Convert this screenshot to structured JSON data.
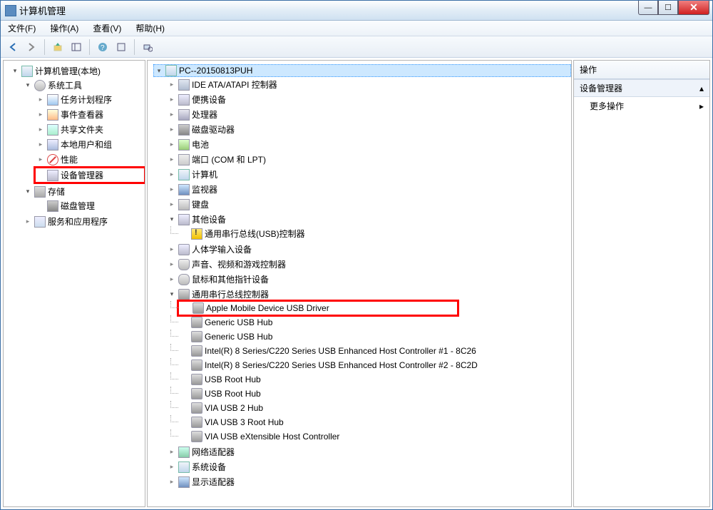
{
  "window": {
    "title": "计算机管理"
  },
  "menu": {
    "file": "文件(F)",
    "action": "操作(A)",
    "view": "查看(V)",
    "help": "帮助(H)"
  },
  "winbtns": {
    "min": "—",
    "max": "☐",
    "close": "✕"
  },
  "nav": {
    "root": "计算机管理(本地)",
    "systools": "系统工具",
    "task": "任务计划程序",
    "event": "事件查看器",
    "share": "共享文件夹",
    "users": "本地用户和组",
    "perf": "性能",
    "devmgr": "设备管理器",
    "storage": "存储",
    "diskmgr": "磁盘管理",
    "services": "服务和应用程序"
  },
  "device": {
    "computer": "PC--20150813PUH",
    "ide": "IDE ATA/ATAPI 控制器",
    "portable": "便携设备",
    "cpu": "处理器",
    "cdrom": "磁盘驱动器",
    "battery": "电池",
    "ports": "端口 (COM 和 LPT)",
    "computers": "计算机",
    "monitor": "监视器",
    "keyboard": "键盘",
    "other": "其他设备",
    "other_usb": "通用串行总线(USB)控制器",
    "hid": "人体学输入设备",
    "audio": "声音、视频和游戏控制器",
    "mouse": "鼠标和其他指针设备",
    "usb": "通用串行总线控制器",
    "usb_items": [
      "Apple Mobile Device USB Driver",
      "Generic USB Hub",
      "Generic USB Hub",
      "Intel(R) 8 Series/C220 Series USB Enhanced Host Controller #1 - 8C26",
      "Intel(R) 8 Series/C220 Series USB Enhanced Host Controller #2 - 8C2D",
      "USB Root Hub",
      "USB Root Hub",
      "VIA USB 2 Hub",
      "VIA USB 3 Root Hub",
      "VIA USB eXtensible Host Controller"
    ],
    "network": "网络适配器",
    "system": "系统设备",
    "display": "显示适配器"
  },
  "actions": {
    "header": "操作",
    "devmgr": "设备管理器",
    "more": "更多操作"
  }
}
